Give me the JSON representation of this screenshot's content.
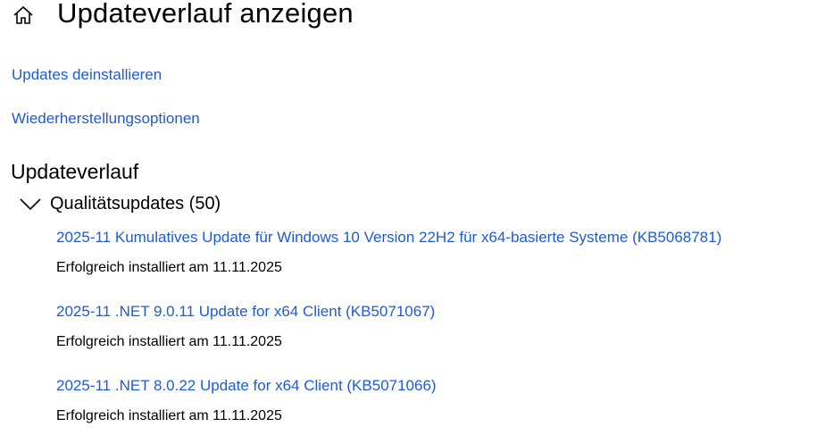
{
  "header": {
    "title": "Updateverlauf anzeigen",
    "home_icon": "home-icon"
  },
  "links": {
    "uninstall": "Updates deinstallieren",
    "recovery": "Wiederherstellungsoptionen"
  },
  "section": {
    "title": "Updateverlauf"
  },
  "group": {
    "label": "Qualitätsupdates (50)",
    "expanded": true,
    "chevron_icon": "chevron-down-icon",
    "updates": [
      {
        "name": "2025-11 Kumulatives Update für Windows 10 Version 22H2 für x64-basierte Systeme (KB5068781)",
        "status": "Erfolgreich installiert am 11.11.2025"
      },
      {
        "name": "2025-11 .NET 9.0.11 Update for x64 Client (KB5071067)",
        "status": "Erfolgreich installiert am 11.11.2025"
      },
      {
        "name": "2025-11 .NET 8.0.22 Update for x64 Client (KB5071066)",
        "status": "Erfolgreich installiert am 11.11.2025"
      }
    ]
  },
  "colors": {
    "link": "#1e5bd6",
    "text": "#000000",
    "background": "#ffffff"
  }
}
